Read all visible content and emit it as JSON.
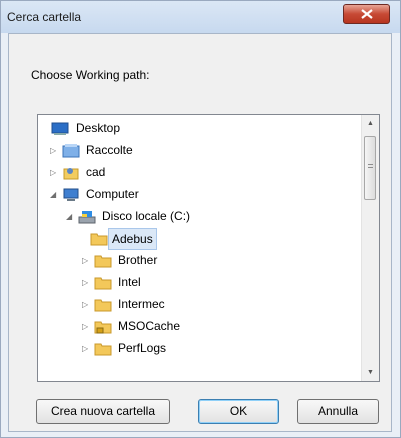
{
  "window": {
    "title": "Cerca cartella"
  },
  "prompt": "Choose Working path:",
  "tree": [
    {
      "label": "Desktop",
      "icon": "desktop-icon",
      "expander": ""
    },
    {
      "label": "Raccolte",
      "icon": "library-icon",
      "expander": "collapsed"
    },
    {
      "label": "cad",
      "icon": "user-folder-icon",
      "expander": "collapsed"
    },
    {
      "label": "Computer",
      "icon": "computer-icon",
      "expander": "expanded"
    },
    {
      "label": "Disco locale (C:)",
      "icon": "drive-icon",
      "expander": "expanded"
    },
    {
      "label": "Adebus",
      "icon": "folder-icon",
      "expander": "",
      "selected": true
    },
    {
      "label": "Brother",
      "icon": "folder-icon",
      "expander": "collapsed"
    },
    {
      "label": "Intel",
      "icon": "folder-icon",
      "expander": "collapsed"
    },
    {
      "label": "Intermec",
      "icon": "folder-icon",
      "expander": "collapsed"
    },
    {
      "label": "MSOCache",
      "icon": "locked-folder-icon",
      "expander": "collapsed"
    },
    {
      "label": "PerfLogs",
      "icon": "folder-icon",
      "expander": "collapsed"
    }
  ],
  "buttons": {
    "new_folder": "Crea nuova cartella",
    "ok": "OK",
    "cancel": "Annulla"
  }
}
